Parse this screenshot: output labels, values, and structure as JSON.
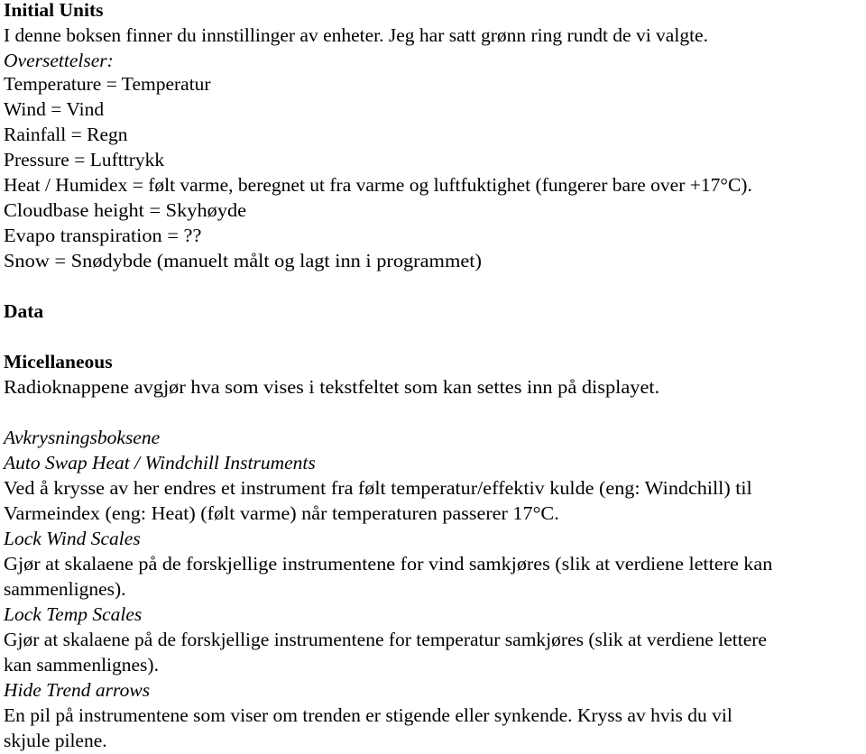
{
  "document": {
    "lines": [
      {
        "text": "Initial Units",
        "style": "bold"
      },
      {
        "text": "I denne boksen finner du innstillinger av enheter. Jeg har satt grønn ring rundt de vi valgte.",
        "style": "normal"
      },
      {
        "text": "Oversettelser:",
        "style": "italic"
      },
      {
        "text": "Temperature = Temperatur",
        "style": "normal"
      },
      {
        "text": "Wind = Vind",
        "style": "normal"
      },
      {
        "text": "Rainfall = Regn",
        "style": "normal"
      },
      {
        "text": "Pressure = Lufttrykk",
        "style": "normal"
      },
      {
        "text": "Heat / Humidex = følt varme, beregnet ut fra varme og luftfuktighet (fungerer bare over +17°C).",
        "style": "normal"
      },
      {
        "text": "Cloudbase height = Skyhøyde",
        "style": "normal"
      },
      {
        "text": "Evapo transpiration = ??",
        "style": "normal"
      },
      {
        "text": "Snow = Snødybde (manuelt målt og lagt inn i programmet)",
        "style": "normal"
      },
      {
        "text": "Data",
        "style": "bold"
      },
      {
        "text": "Micellaneous",
        "style": "bold"
      },
      {
        "text": "Radioknappene avgjør hva som vises i tekstfeltet som kan settes inn på displayet.",
        "style": "normal"
      },
      {
        "text": "Avkrysningsboksene",
        "style": "italic"
      },
      {
        "text": "Auto Swap Heat / Windchill Instruments",
        "style": "italic"
      },
      {
        "text": "Ved å krysse av her endres et instrument fra følt temperatur/effektiv kulde (eng: Windchill) til",
        "style": "normal"
      },
      {
        "text": "Varmeindex (eng: Heat) (følt varme) når temperaturen passerer 17°C.",
        "style": "normal"
      },
      {
        "text": "Lock Wind Scales",
        "style": "italic"
      },
      {
        "text": "Gjør at skalaene på de forskjellige instrumentene for vind samkjøres (slik at verdiene lettere kan",
        "style": "normal"
      },
      {
        "text": "sammenlignes).",
        "style": "normal"
      },
      {
        "text": "Lock Temp Scales",
        "style": "italic"
      },
      {
        "text": "Gjør at skalaene på de forskjellige instrumentene for temperatur samkjøres (slik at verdiene lettere",
        "style": "normal"
      },
      {
        "text": "kan sammenlignes).",
        "style": "normal"
      },
      {
        "text": "Hide Trend arrows",
        "style": "italic"
      },
      {
        "text": "En pil på instrumentene som viser om trenden er stigende eller synkende. Kryss av hvis du vil",
        "style": "normal"
      },
      {
        "text": "skjule pilene.",
        "style": "normal"
      }
    ]
  }
}
